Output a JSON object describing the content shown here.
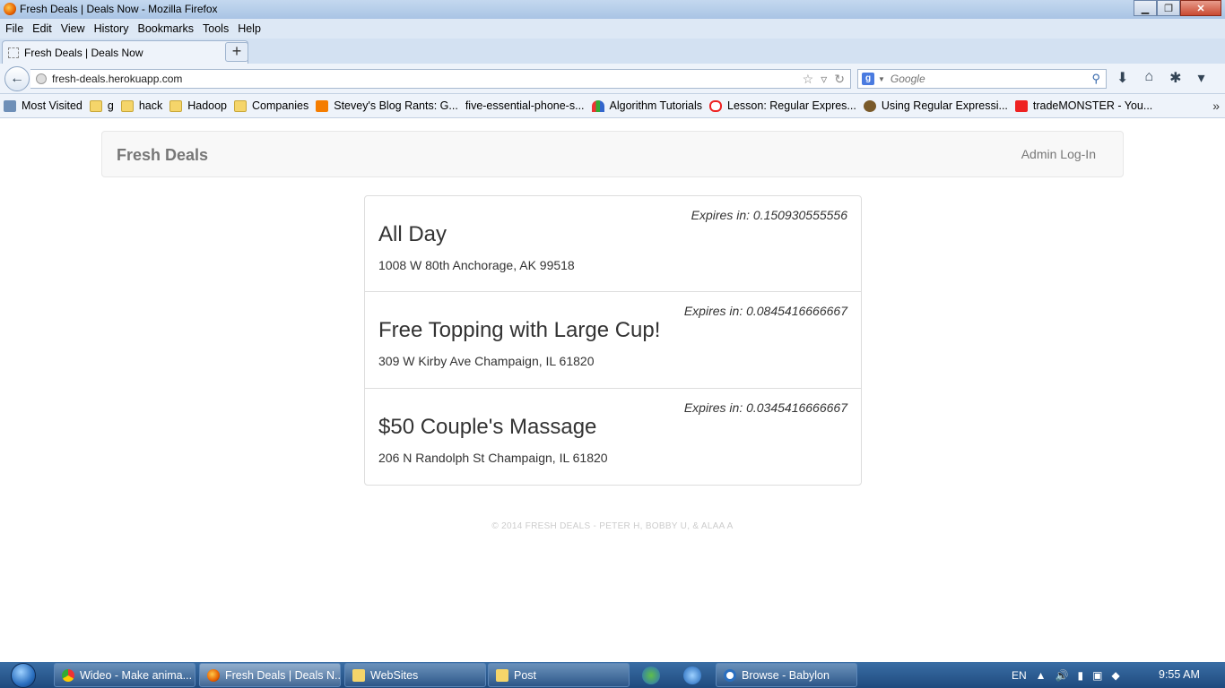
{
  "window": {
    "title": "Fresh Deals | Deals Now - Mozilla Firefox",
    "controls": {
      "minimize": "▁",
      "maximize": "❐",
      "close": "✕"
    }
  },
  "menubar": {
    "items": [
      "File",
      "Edit",
      "View",
      "History",
      "Bookmarks",
      "Tools",
      "Help"
    ]
  },
  "tabs": [
    {
      "label": "Fresh Deals | Deals Now",
      "active": true
    }
  ],
  "newtab_label": "+",
  "navbar": {
    "url": "fresh-deals.herokuapp.com",
    "search_placeholder": "Google"
  },
  "bookmarks": [
    {
      "label": "Most Visited",
      "icon": "most-visited-icon"
    },
    {
      "label": "g",
      "icon": "folder-icon"
    },
    {
      "label": "hack",
      "icon": "folder-icon"
    },
    {
      "label": "Hadoop",
      "icon": "folder-icon"
    },
    {
      "label": "Companies",
      "icon": "folder-icon"
    },
    {
      "label": "Stevey's Blog Rants: G...",
      "icon": "blogger-icon"
    },
    {
      "label": "five-essential-phone-s...",
      "icon": "page-icon"
    },
    {
      "label": "Algorithm Tutorials",
      "icon": "algorithm-icon"
    },
    {
      "label": "Lesson: Regular Expres...",
      "icon": "oracle-icon"
    },
    {
      "label": "Using Regular Expressi...",
      "icon": "owl-icon"
    },
    {
      "label": "tradeMONSTER - You...",
      "icon": "youtube-icon"
    }
  ],
  "site": {
    "brand": "Fresh Deals",
    "admin_link": "Admin Log-In",
    "deals": [
      {
        "title": "All Day",
        "address": "1008 W 80th Anchorage, AK 99518",
        "expires": "Expires in: 0.150930555556"
      },
      {
        "title": "Free Topping with Large Cup!",
        "address": "309 W Kirby Ave Champaign, IL 61820",
        "expires": "Expires in: 0.0845416666667"
      },
      {
        "title": "$50 Couple's Massage",
        "address": "206 N Randolph St Champaign, IL 61820",
        "expires": "Expires in: 0.0345416666667"
      }
    ],
    "footer": "© 2014 FRESH DEALS - PETER H, BOBBY U, & ALAA A"
  },
  "taskbar": {
    "items": [
      {
        "label": "Wideo - Make anima...",
        "icon": "chrome-icon"
      },
      {
        "label": "Fresh Deals | Deals N...",
        "icon": "firefox-icon",
        "active": true
      },
      {
        "label": "WebSites",
        "icon": "folder-icon"
      },
      {
        "label": "Post",
        "icon": "folder-icon"
      },
      {
        "label": "Browse - Babylon",
        "icon": "babylon-icon"
      }
    ],
    "language": "EN",
    "clock": "9:55 AM"
  }
}
